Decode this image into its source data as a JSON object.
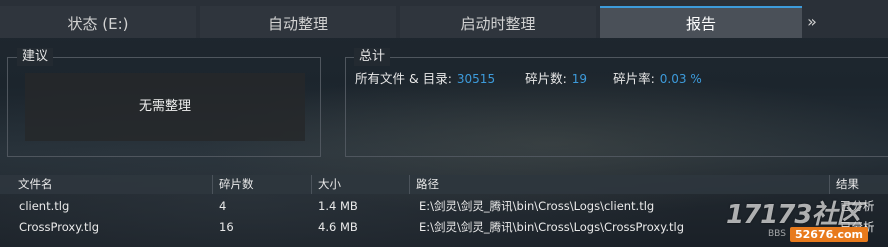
{
  "tabs": [
    {
      "label": "状态 (E:)",
      "active": false
    },
    {
      "label": "自动整理",
      "active": false
    },
    {
      "label": "启动时整理",
      "active": false
    },
    {
      "label": "报告",
      "active": true
    }
  ],
  "tab_overflow": "»",
  "suggestion": {
    "title": "建议",
    "text": "无需整理"
  },
  "summary": {
    "title": "总计",
    "files_label": "所有文件 & 目录:",
    "files_value": "30515",
    "fragments_label": "碎片数:",
    "fragments_value": "19",
    "rate_label": "碎片率:",
    "rate_value": "0.03 %"
  },
  "table": {
    "headers": [
      "文件名",
      "碎片数",
      "大小",
      "路径",
      "结果"
    ],
    "rows": [
      [
        "client.tlg",
        "4",
        "1.4 MB",
        "E:\\剑灵\\剑灵_腾讯\\bin\\Cross\\Logs\\client.tlg",
        "已分析"
      ],
      [
        "CrossProxy.tlg",
        "16",
        "4.6 MB",
        "E:\\剑灵\\剑灵_腾讯\\bin\\Cross\\Logs\\CrossProxy.tlg",
        "已分析"
      ]
    ]
  },
  "watermark": {
    "logo": "17173社区",
    "bbs": "BBS",
    "domain": "52676.com"
  },
  "colors": {
    "accent": "#3d9bdb",
    "tab_active_bg": "#4a5058",
    "tab_bg": "#2f353d",
    "watermark_badge": "#e87a1c"
  },
  "icons": {
    "tab_overflow": "double-chevron-right-icon"
  }
}
